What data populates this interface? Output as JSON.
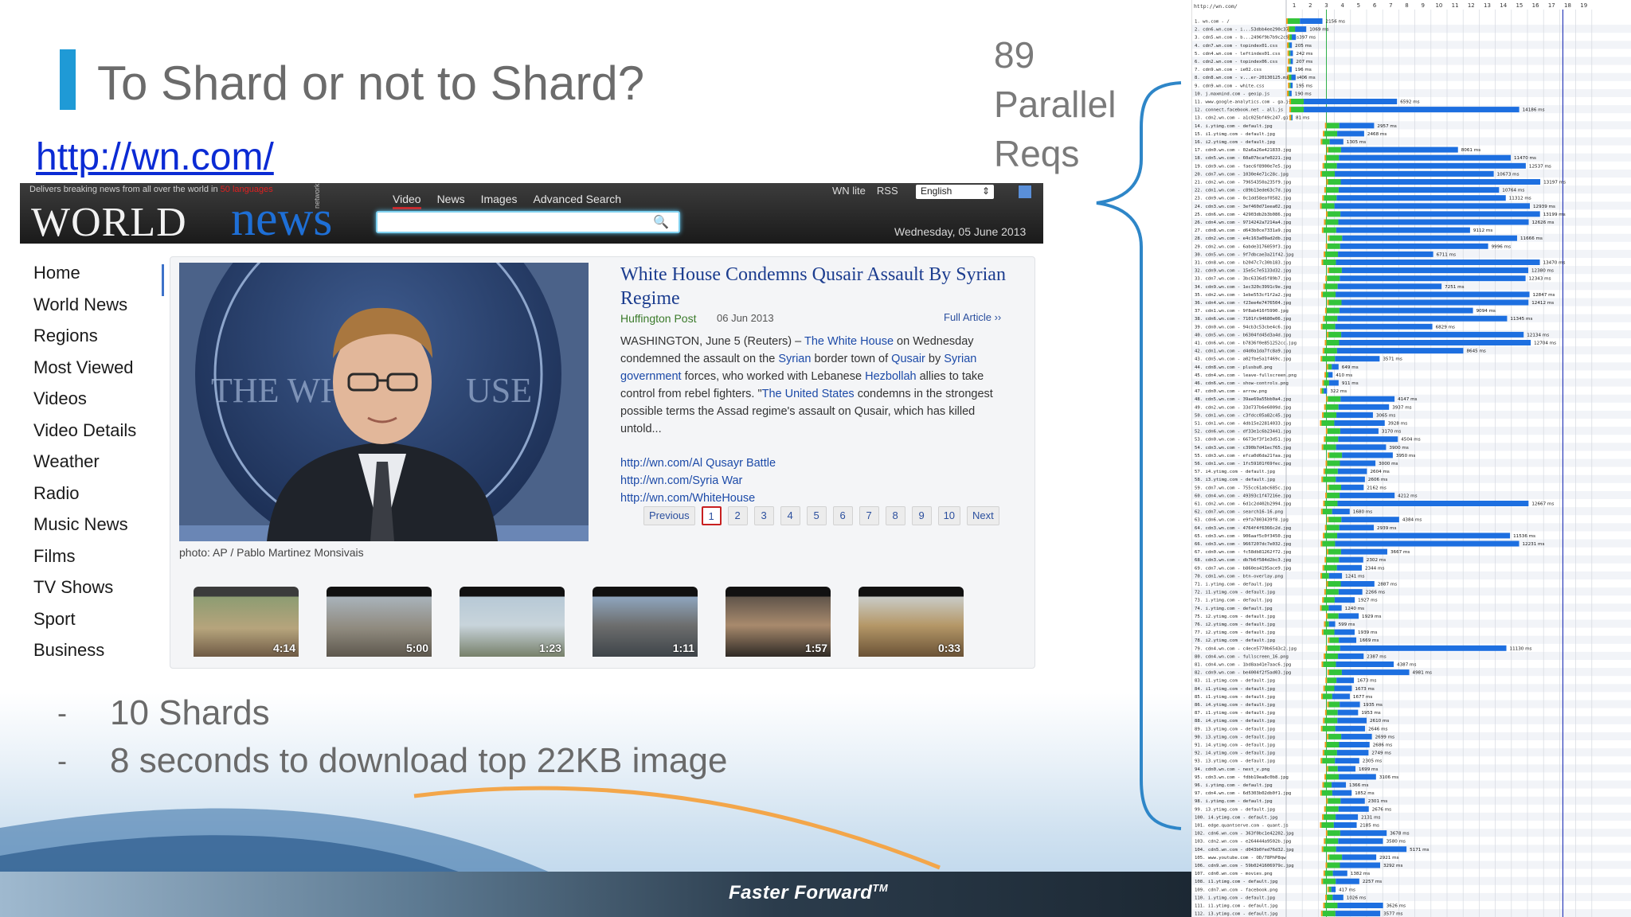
{
  "slide": {
    "title": "To Shard or not to Shard?",
    "url": "http://wn.com/",
    "parallel_lines": [
      "89",
      "Parallel",
      "Reqs"
    ],
    "bullets": [
      "10 Shards",
      "8 seconds to download top 22KB image"
    ],
    "bullet_marker": "-",
    "footer": "Faster Forward",
    "footer_tm": "TM"
  },
  "site": {
    "strap_prefix": "Delivers breaking news from all over the world in",
    "strap_highlight": "50 languages",
    "logo_a": "WORLD",
    "logo_b": "news",
    "logo_network": "network",
    "nav": [
      "Video",
      "News",
      "Images",
      "Advanced Search"
    ],
    "links": [
      "WN lite",
      "RSS"
    ],
    "language": "English",
    "date": "Wednesday, 05 June 2013",
    "sidebar": [
      "Home",
      "World News",
      "Regions",
      "Most Viewed",
      "Videos",
      "Video Details",
      "Weather",
      "Radio",
      "Music News",
      "Films",
      "TV Shows",
      "Sport",
      "Business"
    ],
    "photo_caption": "photo: AP / Pablo Martinez Monsivais",
    "article": {
      "title": "White House Condemns Qusair Assault By Syrian Regime",
      "source": "Huffington Post",
      "date": "06 Jun 2013",
      "full": "Full Article ››",
      "body_1": "WASHINGTON, June 5 (Reuters) – ",
      "body_l1": "The White House",
      "body_2": " on Wednesday condemned the assault on the ",
      "body_l2": "Syrian",
      "body_3": " border town of ",
      "body_l3": "Qusair",
      "body_4": " by ",
      "body_l4": "Syrian government",
      "body_5": " forces, who worked with Lebanese ",
      "body_l5": "Hezbollah",
      "body_6": " allies to take control from rebel fighters. \"",
      "body_l6": "The United States",
      "body_7": " condemns in the strongest possible terms the Assad regime's assault on Qusair, which has killed untold...",
      "links": [
        "http://wn.com/Al Qusayr Battle",
        "http://wn.com/Syria War",
        "http://wn.com/WhiteHouse"
      ]
    },
    "pager": {
      "prev": "Previous",
      "pages": [
        "1",
        "2",
        "3",
        "4",
        "5",
        "6",
        "7",
        "8",
        "9",
        "10"
      ],
      "next": "Next",
      "current": "1"
    },
    "thumb_durations": [
      "4:14",
      "5:00",
      "1:23",
      "1:11",
      "1:57",
      "0:33"
    ]
  },
  "waterfall": {
    "url": "http://wn.com/",
    "seconds": [
      "1",
      "2",
      "3",
      "4",
      "5",
      "6",
      "7",
      "8",
      "9",
      "10",
      "11",
      "12",
      "13",
      "14",
      "15",
      "16",
      "17",
      "18",
      "19"
    ],
    "requests": [
      {
        "n": "1",
        "name": "wn.com - /",
        "ms": "2156 ms"
      },
      {
        "n": "2",
        "name": "cdn6.wn.com - i...53dbb4ee290c37c.js",
        "ms": "1069 ms"
      },
      {
        "n": "3",
        "name": "cdn5.wn.com - b...2496f9b7b9c2c9.css",
        "ms": "397 ms"
      },
      {
        "n": "4",
        "name": "cdn7.wn.com - topindex01.css",
        "ms": "205 ms"
      },
      {
        "n": "5",
        "name": "cdn4.wn.com - leftindex01.css",
        "ms": "242 ms"
      },
      {
        "n": "6",
        "name": "cdn2.wn.com - topindex06.css",
        "ms": "207 ms"
      },
      {
        "n": "7",
        "name": "cdn9.wn.com - ie02.css",
        "ms": "196 ms"
      },
      {
        "n": "8",
        "name": "cdn8.wn.com - v...er-20130125.min.js",
        "ms": "406 ms"
      },
      {
        "n": "9",
        "name": "cdn9.wn.com - white.css",
        "ms": "195 ms"
      },
      {
        "n": "10",
        "name": "j.maxmind.com - geoip.js",
        "ms": "190 ms"
      },
      {
        "n": "11",
        "name": "www.google-analytics.com - ga.js",
        "ms": "6592 ms"
      },
      {
        "n": "12",
        "name": "connect.facebook.net - all.js",
        "ms": "14186 ms"
      },
      {
        "n": "13",
        "name": "cdn2.wn.com - a1c025bf49c247.gif",
        "ms": "81 ms"
      },
      {
        "n": "14",
        "name": "i.ytimg.com - default.jpg",
        "ms": "2957 ms"
      },
      {
        "n": "15",
        "name": "i1.ytimg.com - default.jpg",
        "ms": "2468 ms"
      },
      {
        "n": "16",
        "name": "i2.ytimg.com - default.jpg",
        "ms": "1305 ms"
      },
      {
        "n": "17",
        "name": "cdn0.wn.com - 02a6a26e421833.jpg",
        "ms": "8061 ms"
      },
      {
        "n": "18",
        "name": "cdn5.wn.com - 60a07bcafe0221.jpg",
        "ms": "11470 ms"
      },
      {
        "n": "19",
        "name": "cdn9.wn.com - faec6f8900e7e5.jpg",
        "ms": "12537 ms"
      },
      {
        "n": "20",
        "name": "cdn7.wn.com - 1030e4e71c28c.jpg",
        "ms": "10673 ms"
      },
      {
        "n": "21",
        "name": "cdn2.wn.com - 79654350a235f9.jpg",
        "ms": "13197 ms"
      },
      {
        "n": "22",
        "name": "cdn1.wn.com - c89b13ede63c7d.jpg",
        "ms": "10764 ms"
      },
      {
        "n": "23",
        "name": "cdn9.wn.com - 0c1dd58eaf0582.jpg",
        "ms": "11312 ms"
      },
      {
        "n": "24",
        "name": "cdn3.wn.com - 3ef460d71eea02.jpg",
        "ms": "12939 ms"
      },
      {
        "n": "25",
        "name": "cdn6.wn.com - 42903db2b3b086.jpg",
        "ms": "13199 ms"
      },
      {
        "n": "26",
        "name": "cdn4.wn.com - 9714242a7214a4.jpg",
        "ms": "12626 ms"
      },
      {
        "n": "27",
        "name": "cdn8.wn.com - d643b0ce7331a9.jpg",
        "ms": "9112 ms"
      },
      {
        "n": "28",
        "name": "cdn2.wn.com - e4c163a09ad2db.jpg",
        "ms": "11666 ms"
      },
      {
        "n": "29",
        "name": "cdn2.wn.com - 6abde3176059f3.jpg",
        "ms": "9996 ms"
      },
      {
        "n": "30",
        "name": "cdn5.wn.com - 9f7dbcae3a21f42.jpg",
        "ms": "6711 ms"
      },
      {
        "n": "31",
        "name": "cdn8.wn.com - b2047c7c30b183.jpg",
        "ms": "13470 ms"
      },
      {
        "n": "32",
        "name": "cdn9.wn.com - 15e5c7e5133d32.jpg",
        "ms": "12380 ms"
      },
      {
        "n": "33",
        "name": "cdn7.wn.com - 3bc6336d5f89b7.jpg",
        "ms": "12343 ms"
      },
      {
        "n": "34",
        "name": "cdn9.wn.com - 1ec320c3991c9e.jpg",
        "ms": "7251 ms"
      },
      {
        "n": "35",
        "name": "cdn2.wn.com - 1ebe553cf1f2a2.jpg",
        "ms": "12847 ms"
      },
      {
        "n": "36",
        "name": "cdn4.wn.com - f23ee4e7476504.jpg",
        "ms": "12412 ms"
      },
      {
        "n": "37",
        "name": "cdn1.wn.com - 9f8ab416f5990.jpg",
        "ms": "9094 ms"
      },
      {
        "n": "38",
        "name": "cdn6.wn.com - 7101fc94680e06.jpg",
        "ms": "11345 ms"
      },
      {
        "n": "39",
        "name": "cdn0.wn.com - 94cb3c53cbe4c6.jpg",
        "ms": "6829 ms"
      },
      {
        "n": "40",
        "name": "cdn5.wn.com - b6304fd45d3a4d.jpg",
        "ms": "12134 ms"
      },
      {
        "n": "41",
        "name": "cdn6.wn.com - b7836f0e851252cc.jpg",
        "ms": "12704 ms"
      },
      {
        "n": "42",
        "name": "cdn1.wn.com - d4d0a1da7fc8a9.jpg",
        "ms": "8645 ms"
      },
      {
        "n": "43",
        "name": "cdn5.wn.com - a02fbe5a1f469c.jpg",
        "ms": "3571 ms"
      },
      {
        "n": "44",
        "name": "cdn8.wn.com - plusbu0.png",
        "ms": "649 ms"
      },
      {
        "n": "45",
        "name": "cdn4.wn.com - leave-fullscreen.png",
        "ms": "410 ms"
      },
      {
        "n": "46",
        "name": "cdn6.wn.com - show-controls.png",
        "ms": "911 ms"
      },
      {
        "n": "47",
        "name": "cdn0.wn.com - arrow.png",
        "ms": "322 ms"
      },
      {
        "n": "48",
        "name": "cdn5.wn.com - 39ae69a55bb0a4.jpg",
        "ms": "4147 ms"
      },
      {
        "n": "49",
        "name": "cdn2.wn.com - 33d737b6e6009d.jpg",
        "ms": "3937 ms"
      },
      {
        "n": "50",
        "name": "cdn1.wn.com - c3fdcc05a82c45.jpg",
        "ms": "3065 ms"
      },
      {
        "n": "51",
        "name": "cdn1.wn.com - 4db15e22814033.jpg",
        "ms": "3928 ms"
      },
      {
        "n": "52",
        "name": "cdn6.wn.com - df33e1c6b23441.jpg",
        "ms": "3170 ms"
      },
      {
        "n": "53",
        "name": "cdn0.wn.com - 6673ef3f1e3d51.jpg",
        "ms": "4504 ms"
      },
      {
        "n": "54",
        "name": "cdn3.wn.com - c390b7d41ec765.jpg",
        "ms": "3900 ms"
      },
      {
        "n": "55",
        "name": "cdn3.wn.com - efca0d6da21faa.jpg",
        "ms": "3950 ms"
      },
      {
        "n": "56",
        "name": "cdn1.wn.com - 1fc59101f69fec.jpg",
        "ms": "3000 ms"
      },
      {
        "n": "57",
        "name": "i4.ytimg.com - default.jpg",
        "ms": "2604 ms"
      },
      {
        "n": "58",
        "name": "i3.ytimg.com - default.jpg",
        "ms": "2606 ms"
      },
      {
        "n": "59",
        "name": "cdn7.wn.com - 755cc61abc685c.jpg",
        "ms": "2162 ms"
      },
      {
        "n": "60",
        "name": "cdn4.wn.com - 49393c1f47216e.jpg",
        "ms": "4212 ms"
      },
      {
        "n": "61",
        "name": "cdn2.wn.com - 6d1c2d402b2994.jpg",
        "ms": "12667 ms"
      },
      {
        "n": "62",
        "name": "cdn7.wn.com - search16-16.png",
        "ms": "1680 ms"
      },
      {
        "n": "63",
        "name": "cdn6.wn.com - e9fa7803439f8.jpg",
        "ms": "4384 ms"
      },
      {
        "n": "64",
        "name": "cdn3.wn.com - 4764f4f6366c2d.jpg",
        "ms": "2939 ms"
      },
      {
        "n": "65",
        "name": "cdn3.wn.com - 906aaf5c0f3450.jpg",
        "ms": "11536 ms"
      },
      {
        "n": "66",
        "name": "cdn3.wn.com - 9667207dc7e032.jpg",
        "ms": "12231 ms"
      },
      {
        "n": "67",
        "name": "cdn0.wn.com - fc58db81262f72.jpg",
        "ms": "3667 ms"
      },
      {
        "n": "68",
        "name": "cdn3.wn.com - db7b6f584d2bc3.jpg",
        "ms": "2302 ms"
      },
      {
        "n": "69",
        "name": "cdn7.wn.com - b860ea4195ace9.jpg",
        "ms": "2344 ms"
      },
      {
        "n": "70",
        "name": "cdn1.wn.com - btn-overlay.png",
        "ms": "1241 ms"
      },
      {
        "n": "71",
        "name": "i.ytimg.com - default.jpg",
        "ms": "2887 ms"
      },
      {
        "n": "72",
        "name": "i1.ytimg.com - default.jpg",
        "ms": "2266 ms"
      },
      {
        "n": "73",
        "name": "i.ytimg.com - default.jpg",
        "ms": "1927 ms"
      },
      {
        "n": "74",
        "name": "i.ytimg.com - default.jpg",
        "ms": "1240 ms"
      },
      {
        "n": "75",
        "name": "i2.ytimg.com - default.jpg",
        "ms": "1929 ms"
      },
      {
        "n": "76",
        "name": "i2.ytimg.com - default.jpg",
        "ms": "599 ms"
      },
      {
        "n": "77",
        "name": "i2.ytimg.com - default.jpg",
        "ms": "1939 ms"
      },
      {
        "n": "78",
        "name": "i2.ytimg.com - default.jpg",
        "ms": "1669 ms"
      },
      {
        "n": "79",
        "name": "cdn4.wn.com - c4ece5770b6543c2.jpg",
        "ms": "11130 ms"
      },
      {
        "n": "80",
        "name": "cdn4.wn.com - fullscreen_16.png",
        "ms": "2387 ms"
      },
      {
        "n": "81",
        "name": "cdn4.wn.com - 1bd8aa41e7aac6.jpg",
        "ms": "4387 ms"
      },
      {
        "n": "82",
        "name": "cdn9.wn.com - be4004f2f5ad03.jpg",
        "ms": "4981 ms"
      },
      {
        "n": "83",
        "name": "i1.ytimg.com - default.jpg",
        "ms": "1673 ms"
      },
      {
        "n": "84",
        "name": "i1.ytimg.com - default.jpg",
        "ms": "1673 ms"
      },
      {
        "n": "85",
        "name": "i1.ytimg.com - default.jpg",
        "ms": "1677 ms"
      },
      {
        "n": "86",
        "name": "i4.ytimg.com - default.jpg",
        "ms": "1935 ms"
      },
      {
        "n": "87",
        "name": "i1.ytimg.com - default.jpg",
        "ms": "1953 ms"
      },
      {
        "n": "88",
        "name": "i4.ytimg.com - default.jpg",
        "ms": "2610 ms"
      },
      {
        "n": "89",
        "name": "i3.ytimg.com - default.jpg",
        "ms": "2646 ms"
      },
      {
        "n": "90",
        "name": "i3.ytimg.com - default.jpg",
        "ms": "2699 ms"
      },
      {
        "n": "91",
        "name": "i4.ytimg.com - default.jpg",
        "ms": "2686 ms"
      },
      {
        "n": "92",
        "name": "i4.ytimg.com - default.jpg",
        "ms": "2749 ms"
      },
      {
        "n": "93",
        "name": "i3.ytimg.com - default.jpg",
        "ms": "2305 ms"
      },
      {
        "n": "94",
        "name": "cdn0.wn.com - next_v.png",
        "ms": "1699 ms"
      },
      {
        "n": "95",
        "name": "cdn3.wn.com - fdbb19ea8c0b8.jpg",
        "ms": "3106 ms"
      },
      {
        "n": "96",
        "name": "i.ytimg.com - default.jpg",
        "ms": "1366 ms"
      },
      {
        "n": "97",
        "name": "cdn4.wn.com - 6d5303b02db0f1.jpg",
        "ms": "1852 ms"
      },
      {
        "n": "98",
        "name": "i.ytimg.com - default.jpg",
        "ms": "2301 ms"
      },
      {
        "n": "99",
        "name": "i3.ytimg.com - default.jpg",
        "ms": "2676 ms"
      },
      {
        "n": "100",
        "name": "i4.ytimg.com - default.jpg",
        "ms": "2131 ms"
      },
      {
        "n": "101",
        "name": "edge.quantserve.com - quant.js",
        "ms": "2185 ms"
      },
      {
        "n": "102",
        "name": "cdn6.wn.com - 363f0bc1e42202.jpg",
        "ms": "3678 ms"
      },
      {
        "n": "103",
        "name": "cdn2.wn.com - e264444a9502b.jpg",
        "ms": "3580 ms"
      },
      {
        "n": "104",
        "name": "cdn5.wn.com - d043b0fed76d32.jpg",
        "ms": "5171 ms"
      },
      {
        "n": "105",
        "name": "www.youtube.com - OD/78PhP8qw",
        "ms": "2921 ms"
      },
      {
        "n": "106",
        "name": "cdn9.wn.com - 59b0241606979c.jpg",
        "ms": "3292 ms"
      },
      {
        "n": "107",
        "name": "cdn0.wn.com - movies.png",
        "ms": "1382 ms"
      },
      {
        "n": "108",
        "name": "i1.ytimg.com - default.jpg",
        "ms": "2257 ms"
      },
      {
        "n": "109",
        "name": "cdn7.wn.com - facebook.png",
        "ms": "417 ms"
      },
      {
        "n": "110",
        "name": "i.ytimg.com - default.jpg",
        "ms": "1026 ms"
      },
      {
        "n": "111",
        "name": "i1.ytimg.com - default.jpg",
        "ms": "3626 ms"
      },
      {
        "n": "112",
        "name": "i3.ytimg.com - default.jpg",
        "ms": "3577 ms"
      }
    ]
  },
  "colors": {
    "accent": "#1f9ad6",
    "link": "#0b2bd4",
    "wf_blue": "#1d6fe0",
    "wf_green": "#33c43a",
    "wf_orange": "#f29b1d"
  }
}
